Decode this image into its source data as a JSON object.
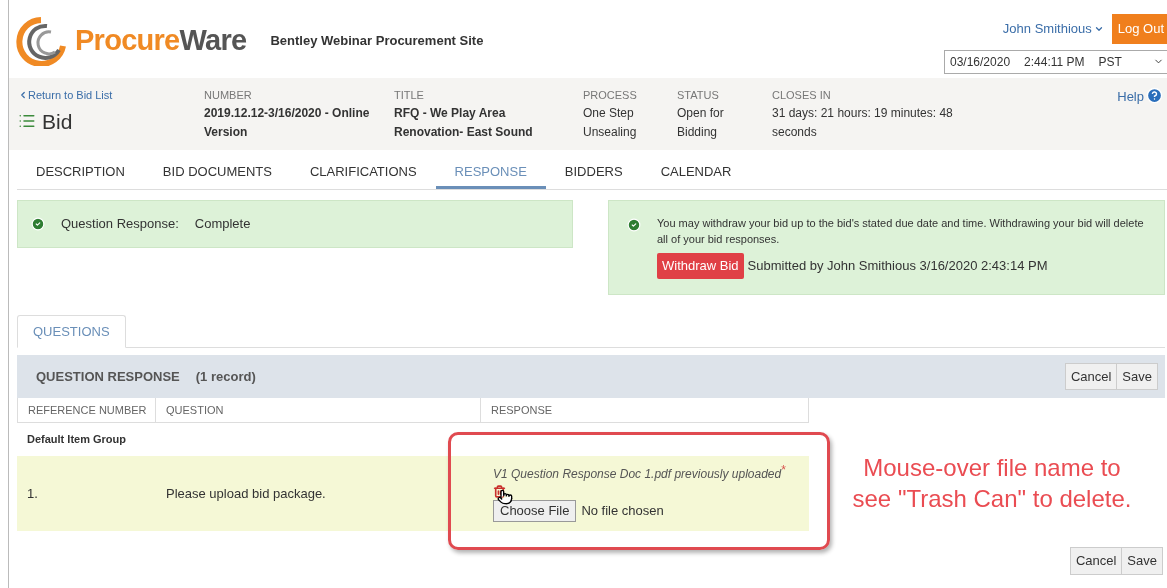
{
  "header": {
    "logo": {
      "part_1": "Procure",
      "part_2": "Ware"
    },
    "site_name": "Bentley Webinar Procurement Site",
    "user": "John Smithious",
    "logout": "Log Out",
    "datetime": {
      "date": "03/16/2020",
      "time": "2:44:11 PM",
      "zone": "PST"
    }
  },
  "bid": {
    "back_link": "Return to Bid List",
    "title": "Bid",
    "help": "Help",
    "fields": [
      {
        "label": "NUMBER",
        "value": "2019.12.12-3/16/2020 - Online Version",
        "bold": true
      },
      {
        "label": "TITLE",
        "value": "RFQ - We Play Area Renovation- East Sound",
        "bold": true
      },
      {
        "label": "PROCESS",
        "value": "One Step Unsealing",
        "bold": false
      },
      {
        "label": "STATUS",
        "value": "Open for Bidding",
        "bold": false
      },
      {
        "label": "CLOSES IN",
        "value": "31 days: 21 hours: 19 minutes: 48 seconds",
        "bold": false
      }
    ]
  },
  "tabs": [
    {
      "label": "DESCRIPTION",
      "selected": false
    },
    {
      "label": "BID DOCUMENTS",
      "selected": false
    },
    {
      "label": "CLARIFICATIONS",
      "selected": false
    },
    {
      "label": "RESPONSE",
      "selected": true
    },
    {
      "label": "BIDDERS",
      "selected": false
    },
    {
      "label": "CALENDAR",
      "selected": false
    }
  ],
  "alerts": {
    "status": {
      "label": "Question Response:",
      "value": "Complete"
    },
    "withdraw": {
      "message": "You may withdraw your bid up to the bid's stated due date and time. Withdrawing your bid will delete all of your bid responses.",
      "button": "Withdraw Bid",
      "submitted": "Submitted by John Smithious 3/16/2020 2:43:14 PM"
    }
  },
  "sub_tabs": [
    {
      "label": "QUESTIONS",
      "selected": true
    }
  ],
  "table": {
    "title": "QUESTION RESPONSE",
    "count": "(1 record)",
    "cancel": "Cancel",
    "save": "Save",
    "columns": [
      "REFERENCE NUMBER",
      "QUESTION",
      "RESPONSE"
    ],
    "group": "Default Item Group",
    "rows": [
      {
        "reference": "1.",
        "question": "Please upload bid package.",
        "file": "V1 Question Response Doc 1.pdf previously uploaded",
        "required_mark": "*",
        "choose": "Choose File",
        "no_file": "No file chosen"
      }
    ]
  },
  "footer": {
    "cancel": "Cancel",
    "save": "Save"
  },
  "annotation": {
    "text": "Mouse-over file name to see \"Trash Can\" to delete."
  }
}
